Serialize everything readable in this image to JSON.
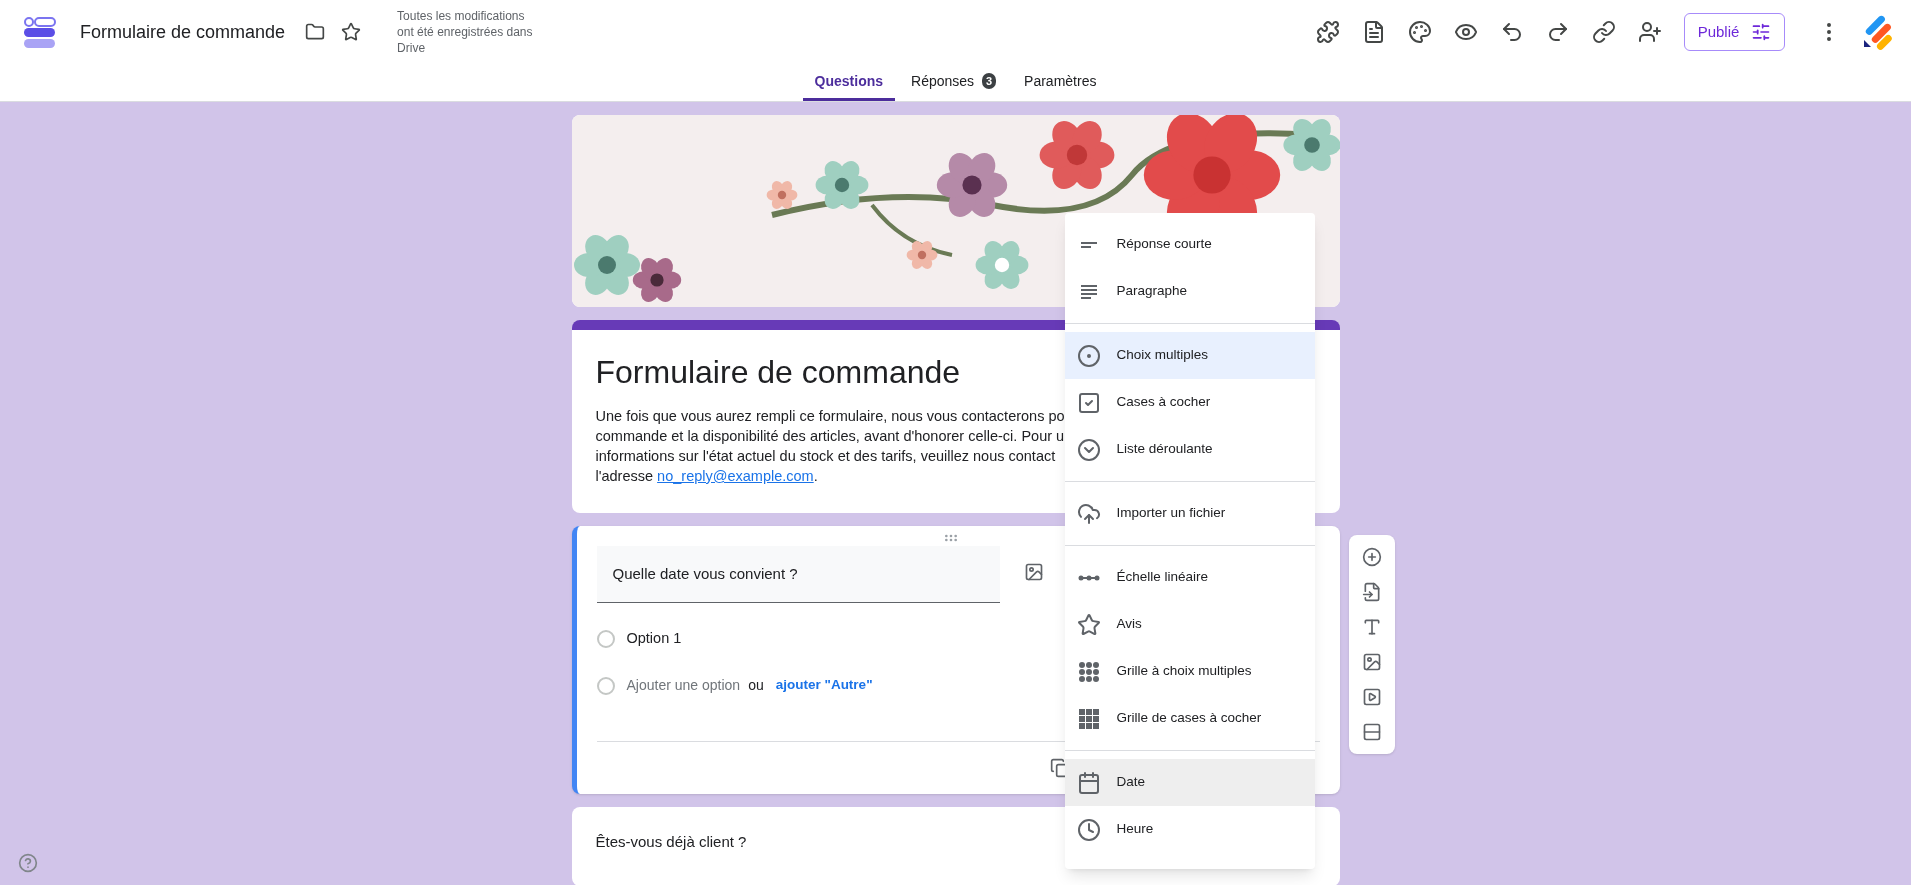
{
  "app": {
    "doc_title": "Formulaire de commande",
    "save_status": "Toutes les modifications ont été enregistrées dans Drive",
    "publish_button": "Publié"
  },
  "tabs": [
    {
      "label": "Questions",
      "selected": true
    },
    {
      "label": "Réponses",
      "selected": false,
      "badge": "3"
    },
    {
      "label": "Paramètres",
      "selected": false
    }
  ],
  "form": {
    "title": "Formulaire de commande",
    "description_lines": [
      "Une fois que vous aurez rempli ce formulaire, nous vous contacterons po",
      "commande et la disponibilité des articles, avant d'honorer celle-ci. Pour u",
      "informations sur l'état actuel du stock et des tarifs, veuillez nous contact"
    ],
    "description_end": {
      "prefix": "l'adresse ",
      "link": "no_reply@example.com",
      "suffix": "."
    }
  },
  "questions": [
    {
      "title": "Quelle date vous convient ?",
      "active": true,
      "options": [
        "Option 1"
      ],
      "add_option": "Ajouter une option",
      "or": "ou",
      "add_other": "ajouter \"Autre\""
    },
    {
      "title": "Êtes-vous déjà client ?",
      "active": false
    }
  ],
  "type_menu": {
    "groups": [
      [
        {
          "kind": "short",
          "label": "Réponse courte",
          "selected": false,
          "hovered": false
        },
        {
          "kind": "paragraph",
          "label": "Paragraphe",
          "selected": false,
          "hovered": false
        }
      ],
      [
        {
          "kind": "radio",
          "label": "Choix multiples",
          "selected": true,
          "hovered": false
        },
        {
          "kind": "checkbox",
          "label": "Cases à cocher",
          "selected": false,
          "hovered": false
        },
        {
          "kind": "dropdown",
          "label": "Liste déroulante",
          "selected": false,
          "hovered": false
        }
      ],
      [
        {
          "kind": "upload",
          "label": "Importer un fichier",
          "selected": false,
          "hovered": false
        }
      ],
      [
        {
          "kind": "scale",
          "label": "Échelle linéaire",
          "selected": false,
          "hovered": false
        },
        {
          "kind": "rating",
          "label": "Avis",
          "selected": false,
          "hovered": false
        },
        {
          "kind": "radio_grid",
          "label": "Grille à choix multiples",
          "selected": false,
          "hovered": false
        },
        {
          "kind": "check_grid",
          "label": "Grille de cases à cocher",
          "selected": false,
          "hovered": false
        }
      ],
      [
        {
          "kind": "date",
          "label": "Date",
          "selected": false,
          "hovered": true
        },
        {
          "kind": "time",
          "label": "Heure",
          "selected": false,
          "hovered": false
        }
      ]
    ]
  }
}
